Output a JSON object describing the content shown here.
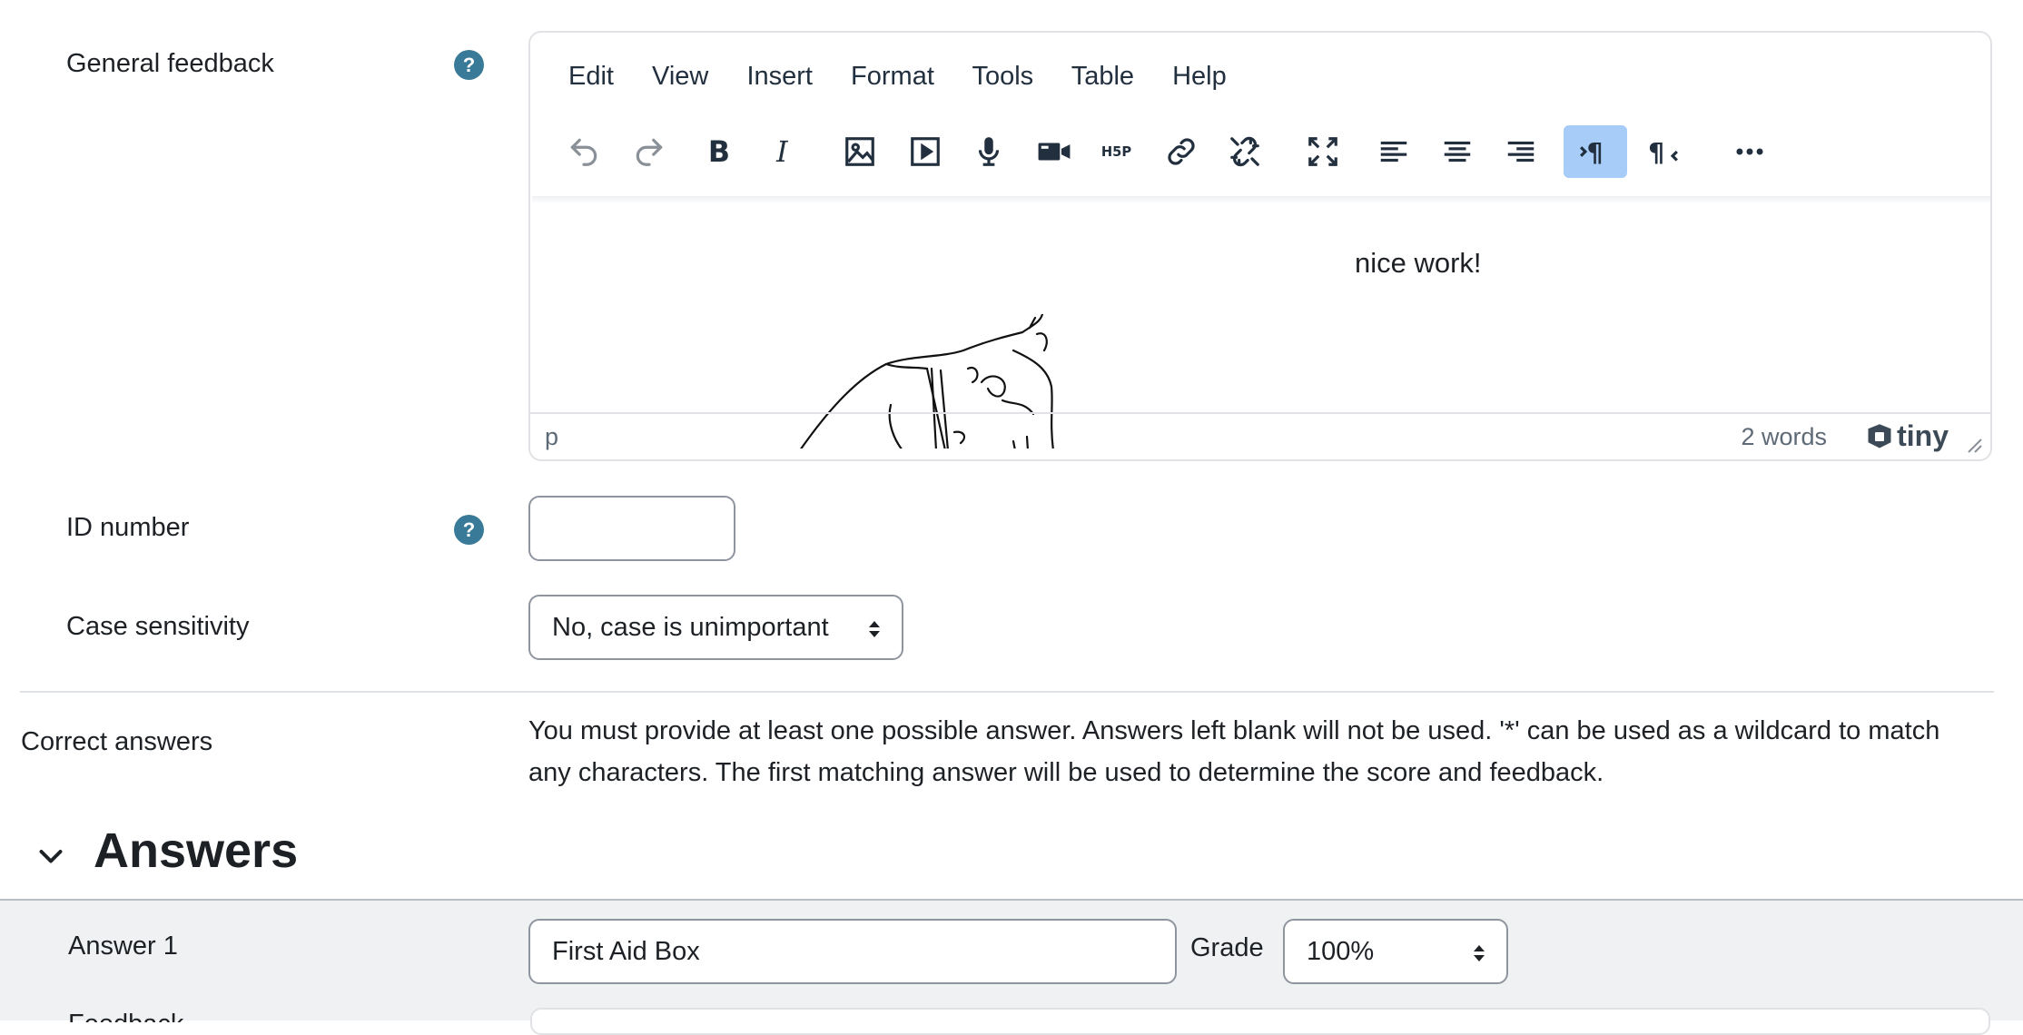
{
  "general_feedback": {
    "label": "General feedback",
    "menu": [
      "Edit",
      "View",
      "Insert",
      "Format",
      "Tools",
      "Table",
      "Help"
    ],
    "content_text": "nice work!",
    "status_path": "p",
    "word_count": "2 words",
    "brand": "tiny"
  },
  "id_number": {
    "label": "ID number",
    "value": ""
  },
  "case_sensitivity": {
    "label": "Case sensitivity",
    "selected": "No, case is unimportant"
  },
  "correct_answers": {
    "label": "Correct answers",
    "description": "You must provide at least one possible answer. Answers left blank will not be used. '*' can be used as a wildcard to match any characters. The first matching answer will be used to determine the score and feedback."
  },
  "answers_section": {
    "heading": "Answers",
    "answer1": {
      "label": "Answer 1",
      "value": "First Aid Box",
      "grade_label": "Grade",
      "grade": "100%"
    },
    "feedback_label": "Feedback"
  },
  "colors": {
    "help": "#3a7a99",
    "active_button": "#a6ccf7"
  }
}
